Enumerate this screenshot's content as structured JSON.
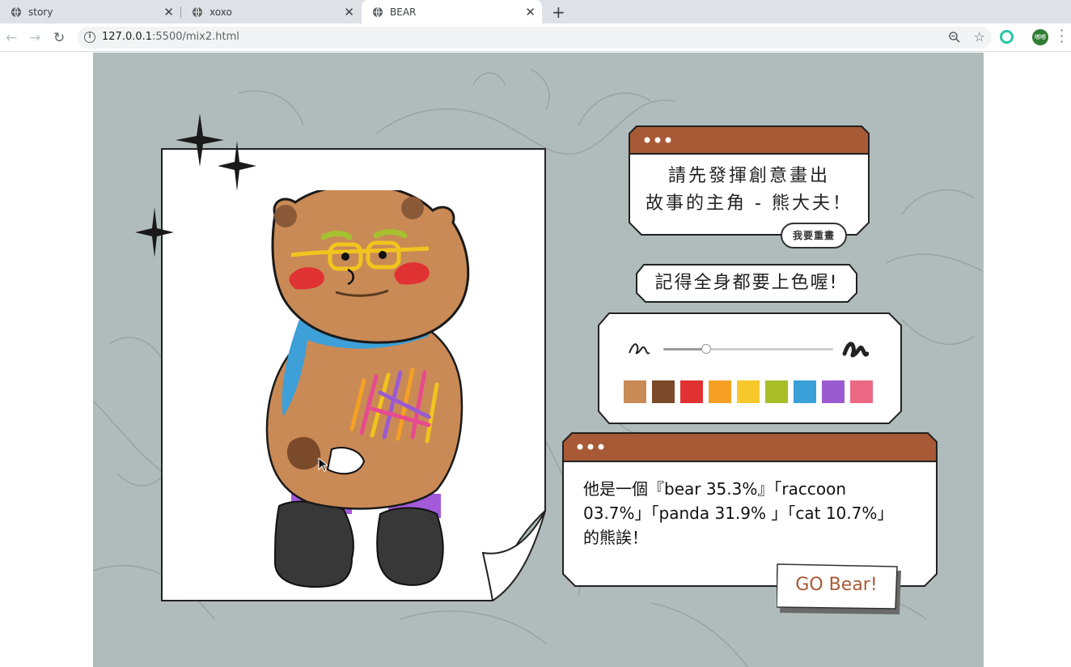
{
  "browser": {
    "tabs": [
      {
        "title": "story"
      },
      {
        "title": "xoxo"
      },
      {
        "title": "BEAR"
      }
    ],
    "url_host": "127.0.0.1",
    "url_rest": ":5500/mix2.html",
    "profile_label": "嘟嘟"
  },
  "page": {
    "intro_line1": "請先發揮創意畫出",
    "intro_line2": "故事的主角 - 熊大夫！",
    "reset_label": "我要重畫",
    "color_hint": "記得全身都要上色喔!",
    "brush_size": 0.25,
    "palette": [
      "#c98a56",
      "#7a4a2a",
      "#e03232",
      "#f5a023",
      "#f8c82a",
      "#a8bf2a",
      "#3aa0d8",
      "#9b5bd0",
      "#ea6883"
    ],
    "result_text": "他是一個『bear 35.3%』「raccoon 03.7%」「panda 31.9% 」「cat 10.7%」的熊誒！",
    "go_label": "GO Bear!"
  },
  "colors": {
    "stage_bg": "#b0bcbc",
    "title_bar": "#a85a36"
  }
}
